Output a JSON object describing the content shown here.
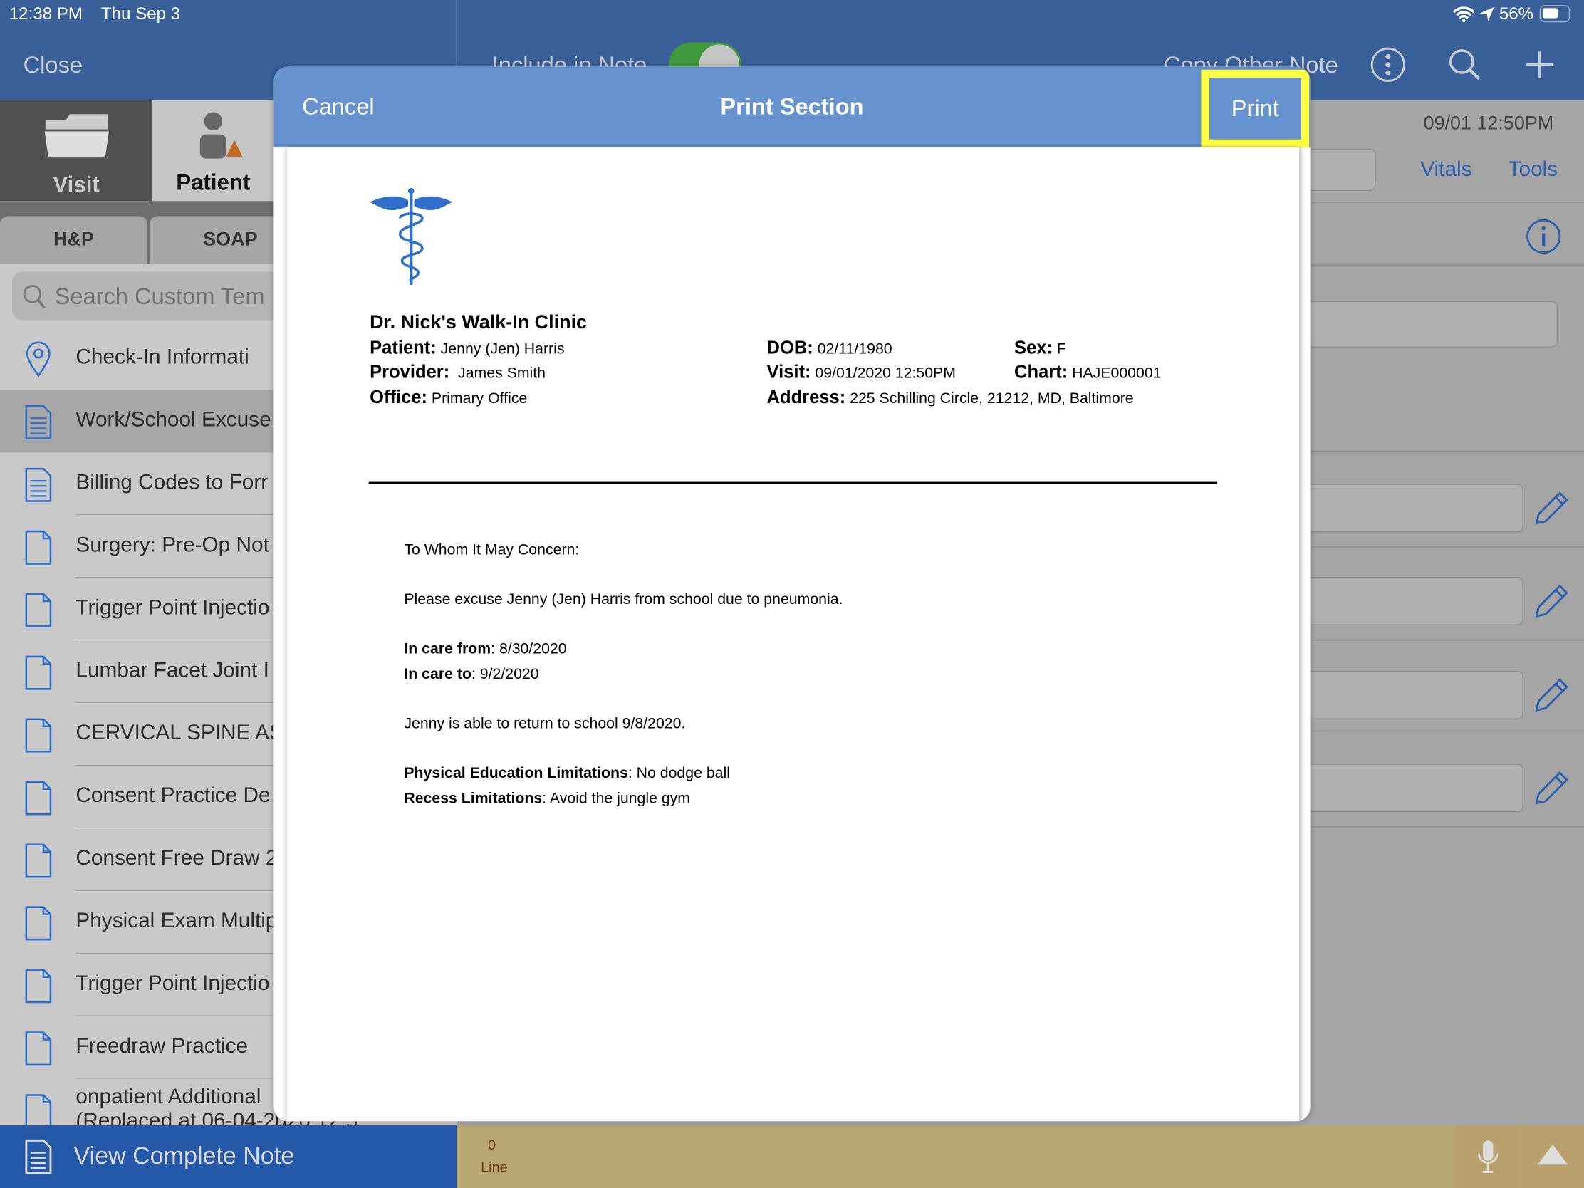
{
  "status_bar": {
    "time": "12:38 PM",
    "date": "Thu Sep 3",
    "battery": "56%",
    "icons": [
      "wifi-icon",
      "location-icon",
      "battery-icon"
    ]
  },
  "nav": {
    "close": "Close",
    "include_in_note": "Include in Note",
    "include_toggle_on": true,
    "copy_other_note": "Copy Other Note",
    "icons": [
      "more-icon",
      "search-icon",
      "plus-icon"
    ]
  },
  "sidebar": {
    "segments": [
      {
        "label": "Visit",
        "icon": "folder-icon"
      },
      {
        "label": "Patient",
        "icon": "person-icon"
      }
    ],
    "tabs": [
      "H&P",
      "SOAP"
    ],
    "search_placeholder": "Search Custom Tem",
    "items": [
      {
        "label": "Check-In Informati",
        "icon": "location-pin-icon"
      },
      {
        "label": "Work/School Excuse",
        "icon": "document-text-icon",
        "selected": true
      },
      {
        "label": "Billing Codes to Forr",
        "icon": "document-text-icon"
      },
      {
        "label": "Surgery: Pre-Op Not",
        "icon": "document-icon"
      },
      {
        "label": "Trigger Point Injectio",
        "icon": "document-icon"
      },
      {
        "label": "Lumbar Facet Joint I",
        "icon": "document-icon"
      },
      {
        "label": "CERVICAL SPINE AS",
        "icon": "document-icon"
      },
      {
        "label": "Consent Practice De",
        "icon": "document-icon"
      },
      {
        "label": "Consent Free Draw 2",
        "icon": "document-icon"
      },
      {
        "label": "Physical Exam Multip",
        "icon": "document-icon"
      },
      {
        "label": "Trigger Point Injectio",
        "icon": "document-icon"
      },
      {
        "label": "Freedraw Practice",
        "icon": "document-icon"
      },
      {
        "label": "onpatient Additional",
        "sub": "(Replaced at 06-04-2020 12:5",
        "icon": "document-icon"
      }
    ]
  },
  "right": {
    "datetime": "09/01 12:50PM",
    "vitals": "Vitals",
    "tools": "Tools"
  },
  "bottom": {
    "view_complete_note": "View Complete Note",
    "line_count": "0",
    "line_label": "Line"
  },
  "modal": {
    "cancel": "Cancel",
    "title": "Print Section",
    "print": "Print",
    "highlight_color": "#ffff44",
    "doc": {
      "clinic": "Dr. Nick's Walk-In Clinic",
      "patient_label": "Patient:",
      "patient": "Jenny (Jen) Harris",
      "provider_label": "Provider:",
      "provider": "James Smith",
      "office_label": "Office:",
      "office": "Primary Office",
      "dob_label": "DOB:",
      "dob": "02/11/1980",
      "visit_label": "Visit:",
      "visit": "09/01/2020 12:50PM",
      "address_label": "Address:",
      "address": "225 Schilling Circle, 21212, MD, Baltimore",
      "sex_label": "Sex:",
      "sex": "F",
      "chart_label": "Chart:",
      "chart": "HAJE000001",
      "salutation": "To Whom It May Concern:",
      "excuse": "Please excuse Jenny (Jen) Harris from school due to pneumonia.",
      "care_from_label": "In care from",
      "care_from": ": 8/30/2020",
      "care_to_label": "In care to",
      "care_to": ": 9/2/2020",
      "return": "Jenny is able to return to school 9/8/2020.",
      "pe_label": "Physical Education Limitations",
      "pe": ": No dodge ball",
      "recess_label": "Recess Limitations",
      "recess": ": Avoid the jungle gym"
    }
  }
}
